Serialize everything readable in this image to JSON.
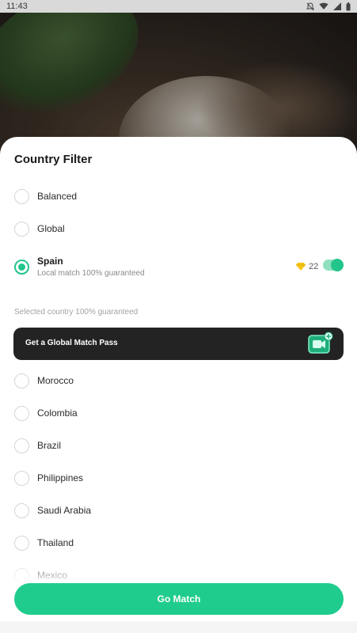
{
  "status_bar": {
    "time": "11:43"
  },
  "sheet": {
    "title": "Country Filter",
    "modes": [
      {
        "label": "Balanced",
        "selected": false
      },
      {
        "label": "Global",
        "selected": false
      },
      {
        "label": "Spain",
        "sublabel": "Local match 100% guaranteed",
        "selected": true,
        "gem_cost": "22",
        "toggle_on": true
      }
    ],
    "section_note": "Selected country 100% guaranteed",
    "pass_banner": {
      "label": "Get a Global Match Pass"
    },
    "countries": [
      {
        "label": "Morocco"
      },
      {
        "label": "Colombia"
      },
      {
        "label": "Brazil"
      },
      {
        "label": "Philippines"
      },
      {
        "label": "Saudi Arabia"
      },
      {
        "label": "Thailand"
      },
      {
        "label": "Mexico"
      }
    ],
    "go_button": "Go Match"
  },
  "colors": {
    "accent": "#20cc8d",
    "banner_bg": "#232323",
    "gem": "#f5c518"
  }
}
